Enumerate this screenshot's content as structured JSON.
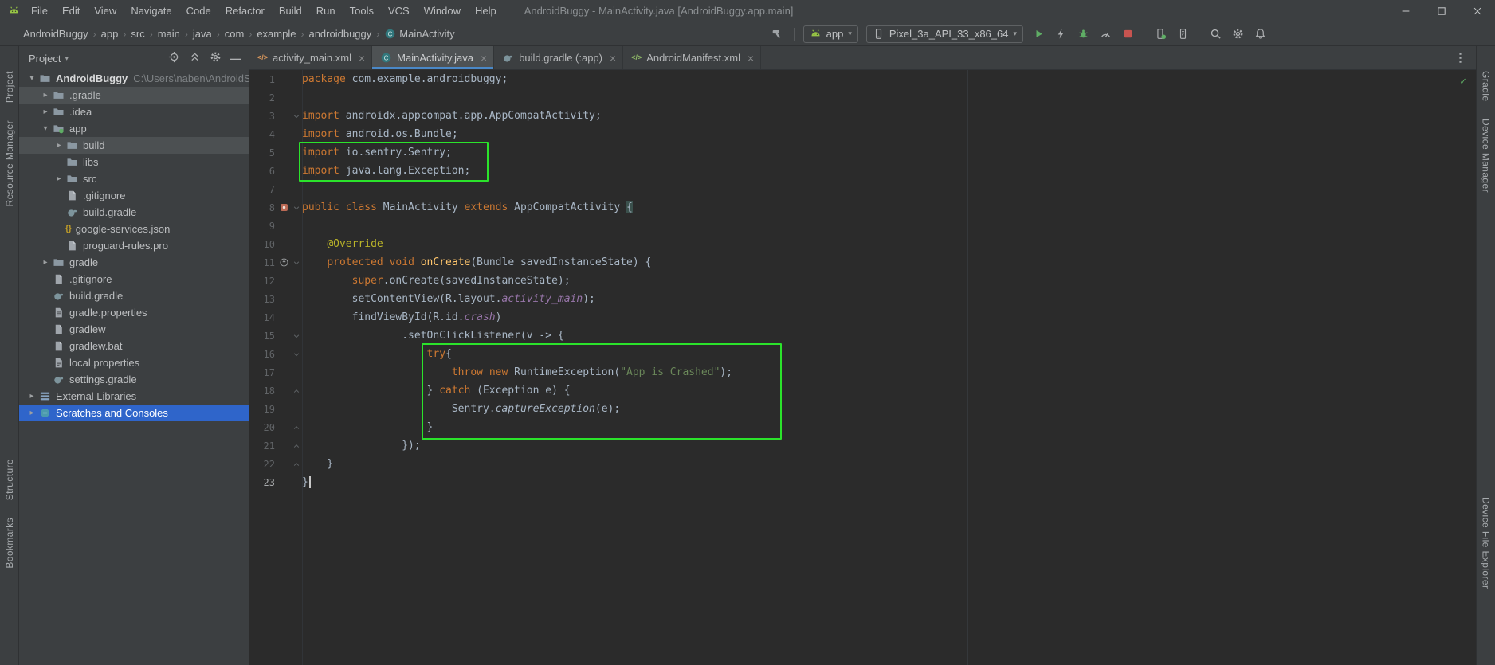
{
  "window": {
    "title": "AndroidBuggy - MainActivity.java [AndroidBuggy.app.main]",
    "menus": [
      "File",
      "Edit",
      "View",
      "Navigate",
      "Code",
      "Refactor",
      "Build",
      "Run",
      "Tools",
      "VCS",
      "Window",
      "Help"
    ],
    "controls": [
      "minimize",
      "maximize",
      "close"
    ],
    "logo_icon": "android-head"
  },
  "navbar": {
    "breadcrumbs": [
      "AndroidBuggy",
      "app",
      "src",
      "main",
      "java",
      "com",
      "example",
      "androidbuggy",
      "MainActivity"
    ],
    "class_crumb": "MainActivity",
    "class_icon": "class"
  },
  "toolbar": {
    "build_icon": "hammer",
    "run_config": {
      "icon": "android-head",
      "label": "app"
    },
    "device": {
      "icon": "phone",
      "label": "Pixel_3a_API_33_x86_64"
    },
    "action_icons": [
      "run",
      "apply-changes",
      "debug",
      "profiler",
      "stop"
    ],
    "device_icons": [
      "device-manager",
      "logcat"
    ],
    "utility_icons": [
      "search",
      "settings",
      "notifications"
    ]
  },
  "stripes": {
    "left_top": [
      "Project",
      "Resource Manager"
    ],
    "left_bottom": [
      "Structure",
      "Bookmarks"
    ],
    "right_top": [
      "Gradle",
      "Device Manager"
    ],
    "right_bottom": [
      "Device File Explorer"
    ]
  },
  "project": {
    "header": "Project",
    "header_icons": [
      "locate",
      "collapse-all",
      "settings",
      "hide"
    ],
    "tree": [
      {
        "label": "AndroidBuggy",
        "hint": "C:\\Users\\naben\\AndroidStud",
        "level": 0,
        "exp": "open",
        "icon": "folder",
        "bold": true
      },
      {
        "label": ".gradle",
        "level": 1,
        "exp": "closed",
        "icon": "folder",
        "hl": "gray"
      },
      {
        "label": ".idea",
        "level": 1,
        "exp": "closed",
        "icon": "folder"
      },
      {
        "label": "app",
        "level": 1,
        "exp": "open",
        "icon": "folder-app"
      },
      {
        "label": "build",
        "level": 2,
        "exp": "closed",
        "icon": "folder",
        "hl": "gray"
      },
      {
        "label": "libs",
        "level": 2,
        "exp": "none",
        "icon": "folder"
      },
      {
        "label": "src",
        "level": 2,
        "exp": "closed",
        "icon": "folder"
      },
      {
        "label": ".gitignore",
        "level": 2,
        "exp": "none",
        "icon": "file-text"
      },
      {
        "label": "build.gradle",
        "level": 2,
        "exp": "none",
        "icon": "file-gradle"
      },
      {
        "label": "google-services.json",
        "level": 2,
        "exp": "none",
        "icon": "file-json"
      },
      {
        "label": "proguard-rules.pro",
        "level": 2,
        "exp": "none",
        "icon": "file-text"
      },
      {
        "label": "gradle",
        "level": 1,
        "exp": "closed",
        "icon": "folder"
      },
      {
        "label": ".gitignore",
        "level": 1,
        "exp": "none",
        "icon": "file-text"
      },
      {
        "label": "build.gradle",
        "level": 1,
        "exp": "none",
        "icon": "file-gradle"
      },
      {
        "label": "gradle.properties",
        "level": 1,
        "exp": "none",
        "icon": "file-props"
      },
      {
        "label": "gradlew",
        "level": 1,
        "exp": "none",
        "icon": "file-text"
      },
      {
        "label": "gradlew.bat",
        "level": 1,
        "exp": "none",
        "icon": "file-text"
      },
      {
        "label": "local.properties",
        "level": 1,
        "exp": "none",
        "icon": "file-props"
      },
      {
        "label": "settings.gradle",
        "level": 1,
        "exp": "none",
        "icon": "file-gradle"
      },
      {
        "label": "External Libraries",
        "level": 0,
        "exp": "closed",
        "icon": "libraries"
      },
      {
        "label": "Scratches and Consoles",
        "level": 0,
        "exp": "closed",
        "icon": "scratches",
        "hl": "blue"
      }
    ]
  },
  "editor": {
    "tabs": [
      {
        "label": "activity_main.xml",
        "icon": "file-xml",
        "active": false
      },
      {
        "label": "MainActivity.java",
        "icon": "class",
        "active": true
      },
      {
        "label": "build.gradle (:app)",
        "icon": "file-gradle",
        "active": false
      },
      {
        "label": "AndroidManifest.xml",
        "icon": "file-manifest",
        "active": false
      }
    ],
    "tabs_more_icon": "more-v",
    "inspection_icon": "check",
    "code": [
      {
        "n": 1,
        "t": [
          [
            "k",
            "package"
          ],
          [
            "p",
            " com.example.androidbuggy;"
          ]
        ]
      },
      {
        "n": 2,
        "t": []
      },
      {
        "n": 3,
        "fold": "down",
        "t": [
          [
            "k",
            "import"
          ],
          [
            "p",
            " androidx.appcompat.app.AppCompatActivity;"
          ]
        ]
      },
      {
        "n": 4,
        "t": [
          [
            "k",
            "import"
          ],
          [
            "p",
            " android.os.Bundle;"
          ]
        ]
      },
      {
        "n": 5,
        "t": [
          [
            "k",
            "import"
          ],
          [
            "p",
            " io.sentry.Sentry;"
          ]
        ]
      },
      {
        "n": 6,
        "t": [
          [
            "k",
            "import"
          ],
          [
            "p",
            " java.lang.Exception;"
          ]
        ]
      },
      {
        "n": 7,
        "t": []
      },
      {
        "n": 8,
        "gutter": "android",
        "fold": "down",
        "t": [
          [
            "k",
            "public"
          ],
          [
            "p",
            " "
          ],
          [
            "k",
            "class"
          ],
          [
            "p",
            " MainActivity "
          ],
          [
            "k",
            "extends"
          ],
          [
            "p",
            " AppCompatActivity "
          ],
          [
            "br",
            "{"
          ]
        ]
      },
      {
        "n": 9,
        "t": []
      },
      {
        "n": 10,
        "t": [
          [
            "p",
            "    "
          ],
          [
            "a",
            "@Override"
          ]
        ]
      },
      {
        "n": 11,
        "gutter": "override",
        "fold": "down",
        "t": [
          [
            "p",
            "    "
          ],
          [
            "k",
            "protected"
          ],
          [
            "p",
            " "
          ],
          [
            "k",
            "void"
          ],
          [
            "p",
            " "
          ],
          [
            "d",
            "onCreate"
          ],
          [
            "p",
            "(Bundle savedInstanceState) {"
          ]
        ]
      },
      {
        "n": 12,
        "t": [
          [
            "p",
            "        "
          ],
          [
            "k",
            "super"
          ],
          [
            "p",
            ".onCreate(savedInstanceState);"
          ]
        ]
      },
      {
        "n": 13,
        "t": [
          [
            "p",
            "        setContentView(R.layout."
          ],
          [
            "f",
            "activity_main"
          ],
          [
            "p",
            ");"
          ]
        ]
      },
      {
        "n": 14,
        "t": [
          [
            "p",
            "        findViewById(R.id."
          ],
          [
            "f",
            "crash"
          ],
          [
            "p",
            ")"
          ]
        ]
      },
      {
        "n": 15,
        "fold": "down",
        "t": [
          [
            "p",
            "                .setOnClickListener(v -> {"
          ]
        ]
      },
      {
        "n": 16,
        "fold": "down",
        "t": [
          [
            "p",
            "                    "
          ],
          [
            "k",
            "try"
          ],
          [
            "p",
            "{"
          ]
        ]
      },
      {
        "n": 17,
        "t": [
          [
            "p",
            "                        "
          ],
          [
            "k",
            "throw"
          ],
          [
            "p",
            " "
          ],
          [
            "k",
            "new"
          ],
          [
            "p",
            " RuntimeException("
          ],
          [
            "s",
            "\"App is Crashed\""
          ],
          [
            "p",
            ");"
          ]
        ]
      },
      {
        "n": 18,
        "fold": "up",
        "t": [
          [
            "p",
            "                    } "
          ],
          [
            "k",
            "catch"
          ],
          [
            "p",
            " (Exception e) {"
          ]
        ]
      },
      {
        "n": 19,
        "t": [
          [
            "p",
            "                        Sent",
            "p2",
            ""
          ],
          [
            "p",
            "ry."
          ],
          [
            "m",
            "captureException"
          ],
          [
            "p",
            "(e);"
          ]
        ]
      },
      {
        "n": 20,
        "fold": "up",
        "t": [
          [
            "p",
            "                    }"
          ]
        ]
      },
      {
        "n": 21,
        "fold": "up",
        "t": [
          [
            "p",
            "                });"
          ]
        ]
      },
      {
        "n": 22,
        "fold": "up",
        "t": [
          [
            "p",
            "    }"
          ]
        ]
      },
      {
        "n": 23,
        "current": true,
        "caret": true,
        "t": [
          [
            "p",
            "}"
          ]
        ]
      }
    ]
  },
  "annotations": [
    {
      "id": "box-imports",
      "meaning": "sentry-import-highlight",
      "lines": [
        5,
        6
      ]
    },
    {
      "id": "box-trycatch",
      "meaning": "try-catch-highlight",
      "lines": [
        16,
        20
      ]
    }
  ],
  "colors": {
    "selection_blue": "#2f65ca",
    "row_gray": "#4c5052",
    "annotation_green": "#2be32b",
    "tab_underline": "#4a88c7",
    "keyword_orange": "#cc7832",
    "string_green": "#6a8759"
  }
}
